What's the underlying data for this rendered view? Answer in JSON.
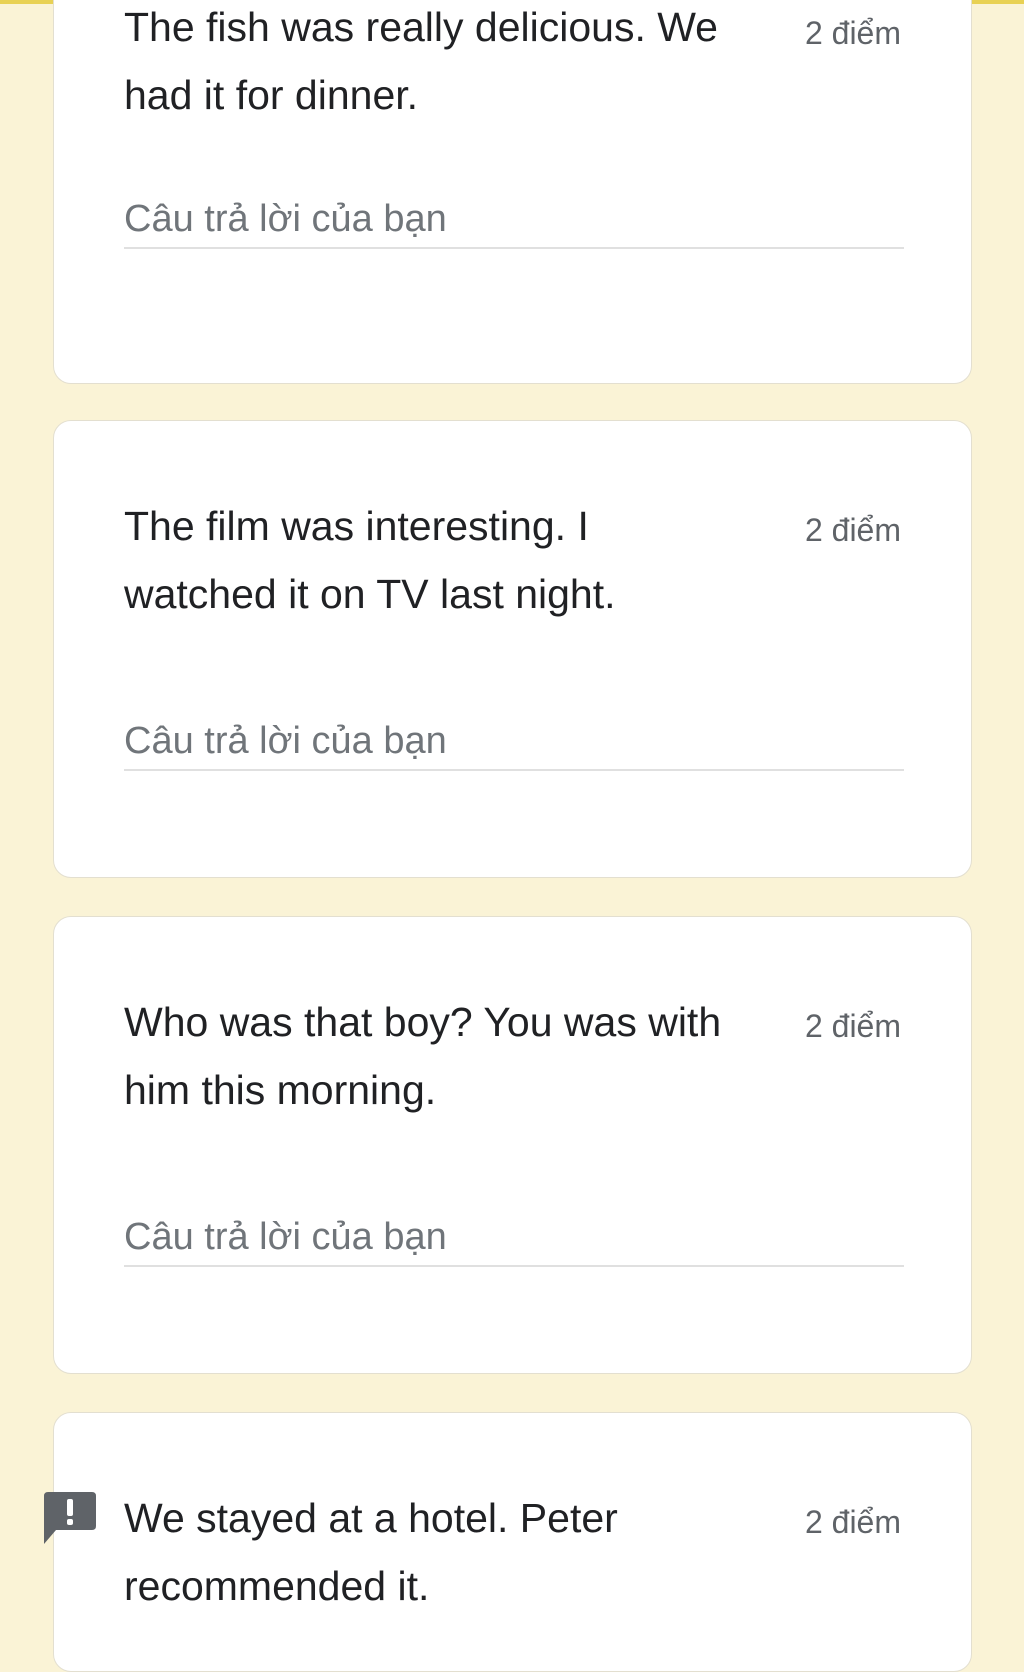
{
  "questions": [
    {
      "text": "The fish was really delicious. We had it for dinner.",
      "points": "2 điểm",
      "answer_placeholder": "Câu trả lời của bạn",
      "answer_value": ""
    },
    {
      "text": "The film was interesting. I watched it on TV last night.",
      "points": "2 điểm",
      "answer_placeholder": "Câu trả lời của bạn",
      "answer_value": ""
    },
    {
      "text": "Who was that boy? You was with him this morning.",
      "points": "2 điểm",
      "answer_placeholder": "Câu trả lời của bạn",
      "answer_value": ""
    },
    {
      "text": "We stayed at a hotel. Peter recommended it.",
      "points": "2 điểm"
    }
  ],
  "icons": {
    "flag": "report-flag-icon"
  },
  "colors": {
    "background": "#faf3d6",
    "accent": "#e8d154",
    "card": "#ffffff",
    "text": "#202124",
    "muted": "#5f6368"
  }
}
